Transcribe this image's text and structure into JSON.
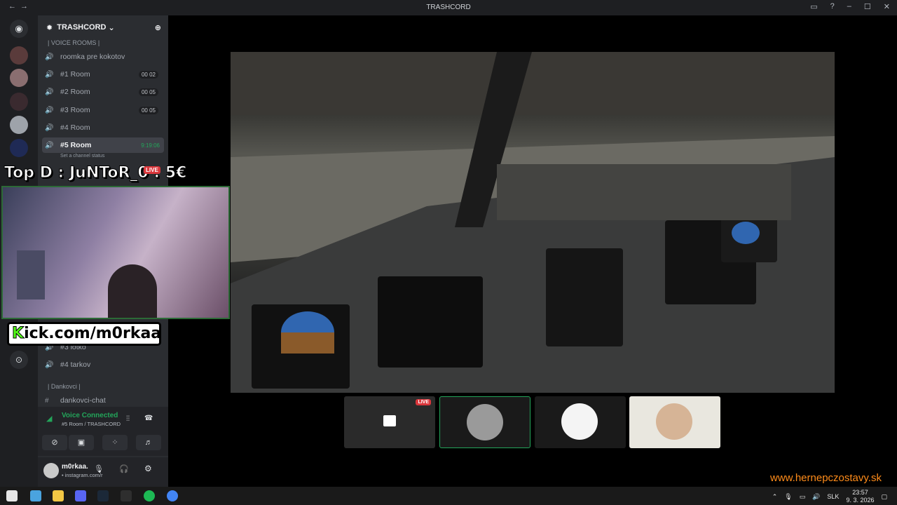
{
  "window": {
    "title": "TRASHCORD",
    "nav_back": "←",
    "nav_forward": "→",
    "min": "–",
    "max": "☐",
    "close": "✕"
  },
  "server": {
    "name": "TRASHCORD",
    "chevron": "⌄",
    "invite_icon": "person-add-icon"
  },
  "categories": {
    "voice_rooms": "| VOICE ROOMS |",
    "dankovci": "| Dankovci |"
  },
  "channels": [
    {
      "name": "roomka pre kokotov",
      "count": ""
    },
    {
      "name": "#1 Room",
      "count": "00  02"
    },
    {
      "name": "#2 Room",
      "count": "00  05"
    },
    {
      "name": "#3 Room",
      "count": "00  05"
    },
    {
      "name": "#4 Room",
      "count": ""
    },
    {
      "name": "#5 Room",
      "timer": "9:19:06"
    }
  ],
  "channel_status_placeholder": "Set a channel status",
  "lower_channels": [
    {
      "name": "#3 lotko"
    },
    {
      "name": "#4 tarkov"
    }
  ],
  "text_channel": "dankovci-chat",
  "voice": {
    "status": "Voice Connected",
    "location": "#5 Room / TRASHCORD"
  },
  "user": {
    "name": "m0rkaa.",
    "status": "• instagram.com/r"
  },
  "overlay": {
    "top_donation": "Top D : JuNToR_0 : 5€",
    "kick_prefix": "K",
    "kick_rest": "ick.com/m0rkaa",
    "live_badge": "LIVE",
    "watermark": "www.hernepczostavy.sk"
  },
  "participants": [
    {
      "name": "stream-tile",
      "live": "LIVE"
    },
    {
      "name": "avatar-tile-2"
    },
    {
      "name": "avatar-tile-3"
    },
    {
      "name": "avatar-tile-4"
    }
  ],
  "taskbar": {
    "lang": "SLK",
    "time": "23:57",
    "date": "9. 3. 2026"
  },
  "colors": {
    "accent_green": "#23a55a",
    "kick_green": "#53fc18",
    "watermark": "#ff8c1a"
  }
}
